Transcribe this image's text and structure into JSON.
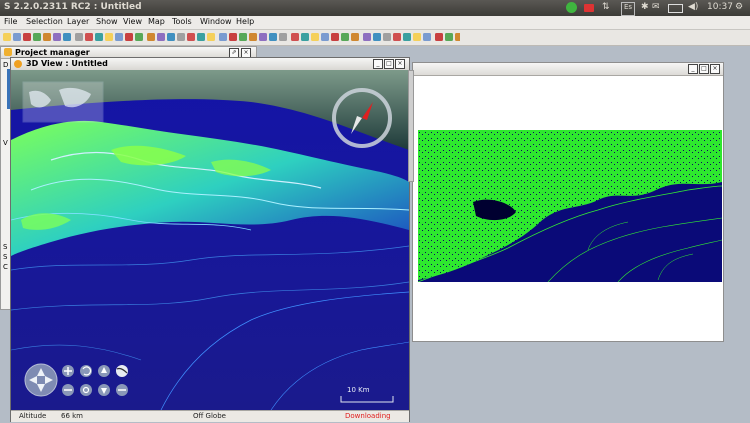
{
  "app": {
    "title": "S 2.2.0.2311 RC2 : Untitled",
    "clock": "10:37",
    "kbd": "Es"
  },
  "menus": [
    "File",
    "Selection",
    "Layer",
    "Show",
    "View",
    "Map",
    "Tools",
    "Window",
    "Help"
  ],
  "project_manager": {
    "title": "Project manager",
    "clipped_letters": [
      "D",
      "V",
      "S",
      "S",
      "C"
    ]
  },
  "view3d": {
    "title": "3D View : Untitled",
    "scale_label": "10 Km",
    "status": {
      "altitude_label": "Altitude",
      "altitude_value": "66 km",
      "globe_status": "Off Globe",
      "download_status": "Downloading"
    }
  },
  "colors": {
    "accent_green": "#33ee33",
    "terrain_blue": "#1010a0",
    "download_red": "#e02020",
    "ubuntu_bar": "#3c3b37"
  },
  "icons": [
    "pm-icon",
    "view3d-icon",
    "compass-icon",
    "navigation-icon",
    "zoom-in-icon",
    "zoom-out-icon",
    "reset-icon",
    "globe-icon",
    "record-icon",
    "wifi-icon",
    "mail-icon",
    "battery-icon",
    "power-icon"
  ]
}
